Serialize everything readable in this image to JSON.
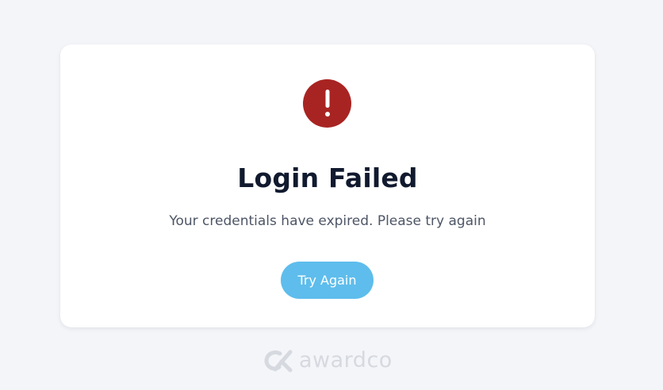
{
  "dialog": {
    "icon": "exclamation-circle-icon",
    "icon_color": "#a82422",
    "title": "Login Failed",
    "message": "Your credentials have expired. Please try again",
    "button_label": "Try Again",
    "button_color": "#5ebdec"
  },
  "footer": {
    "brand_icon": "awardco-logo-icon",
    "brand_name": "awardco"
  }
}
